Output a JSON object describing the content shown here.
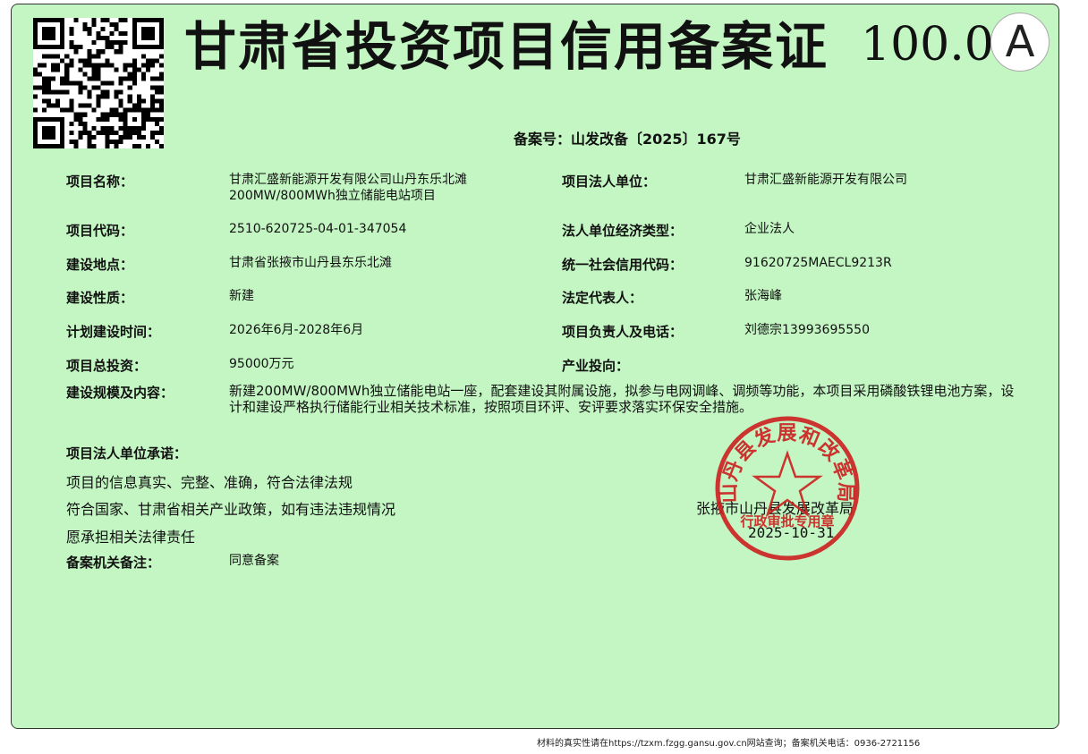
{
  "document": {
    "title": "甘肃省投资项目信用备案证",
    "score": "100.0",
    "grade": "A",
    "filing_no": "备案号：山发改备〔2025〕167号"
  },
  "fields": {
    "project_name_label": "项目名称：",
    "project_name_value": "甘肃汇盛新能源开发有限公司山丹东乐北滩200MW/800MWh独立储能电站项目",
    "legal_unit_label": "项目法人单位：",
    "legal_unit_value": "甘肃汇盛新能源开发有限公司",
    "project_code_label": "项目代码：",
    "project_code_value": "2510-620725-04-01-347054",
    "economy_type_label": "法人单位经济类型：",
    "economy_type_value": "企业法人",
    "location_label": "建设地点：",
    "location_value": "甘肃省张掖市山丹县东乐北滩",
    "credit_code_label": "统一社会信用代码：",
    "credit_code_value": "91620725MAECL9213R",
    "nature_label": "建设性质：",
    "nature_value": "新建",
    "legal_rep_label": "法定代表人：",
    "legal_rep_value": "张海峰",
    "time_label": "计划建设时间：",
    "time_value": "2026年6月-2028年6月",
    "contact_label": "项目负责人及电话：",
    "contact_value": "刘德宗13993695550",
    "investment_label": "项目总投资：",
    "investment_value": "95000万元",
    "industry_label": "产业投向：",
    "industry_value": "",
    "scale_label": "建设规模及内容：",
    "scale_value": "新建200MW/800MWh独立储能电站一座，配套建设其附属设施，拟参与电网调峰、调频等功能，本项目采用磷酸铁锂电池方案，设计和建设严格执行储能行业相关技术标准，按照项目环评、安评要求落实环保安全措施。",
    "commitment_label": "项目法人单位承诺：",
    "commitments": [
      "项目的信息真实、完整、准确，符合法律法规",
      "符合国家、甘肃省相关产业政策，如有违法违规情况",
      "愿承担相关法律责任"
    ],
    "remark_label": "备案机关备注：",
    "remark_value": "同意备案"
  },
  "issuer": {
    "agency": "张掖市山丹县发展改革局",
    "date": "2025-10-31",
    "seal_text": "山丹县发展和改革局",
    "seal_sub": "行政审批专用章"
  },
  "footer": "材料的真实性请在https://tzxm.fzgg.gansu.gov.cn网站查询；备案机关电话：0936-2721156",
  "colors": {
    "background": "#c3f6c3",
    "seal": "#cc1f1f"
  }
}
